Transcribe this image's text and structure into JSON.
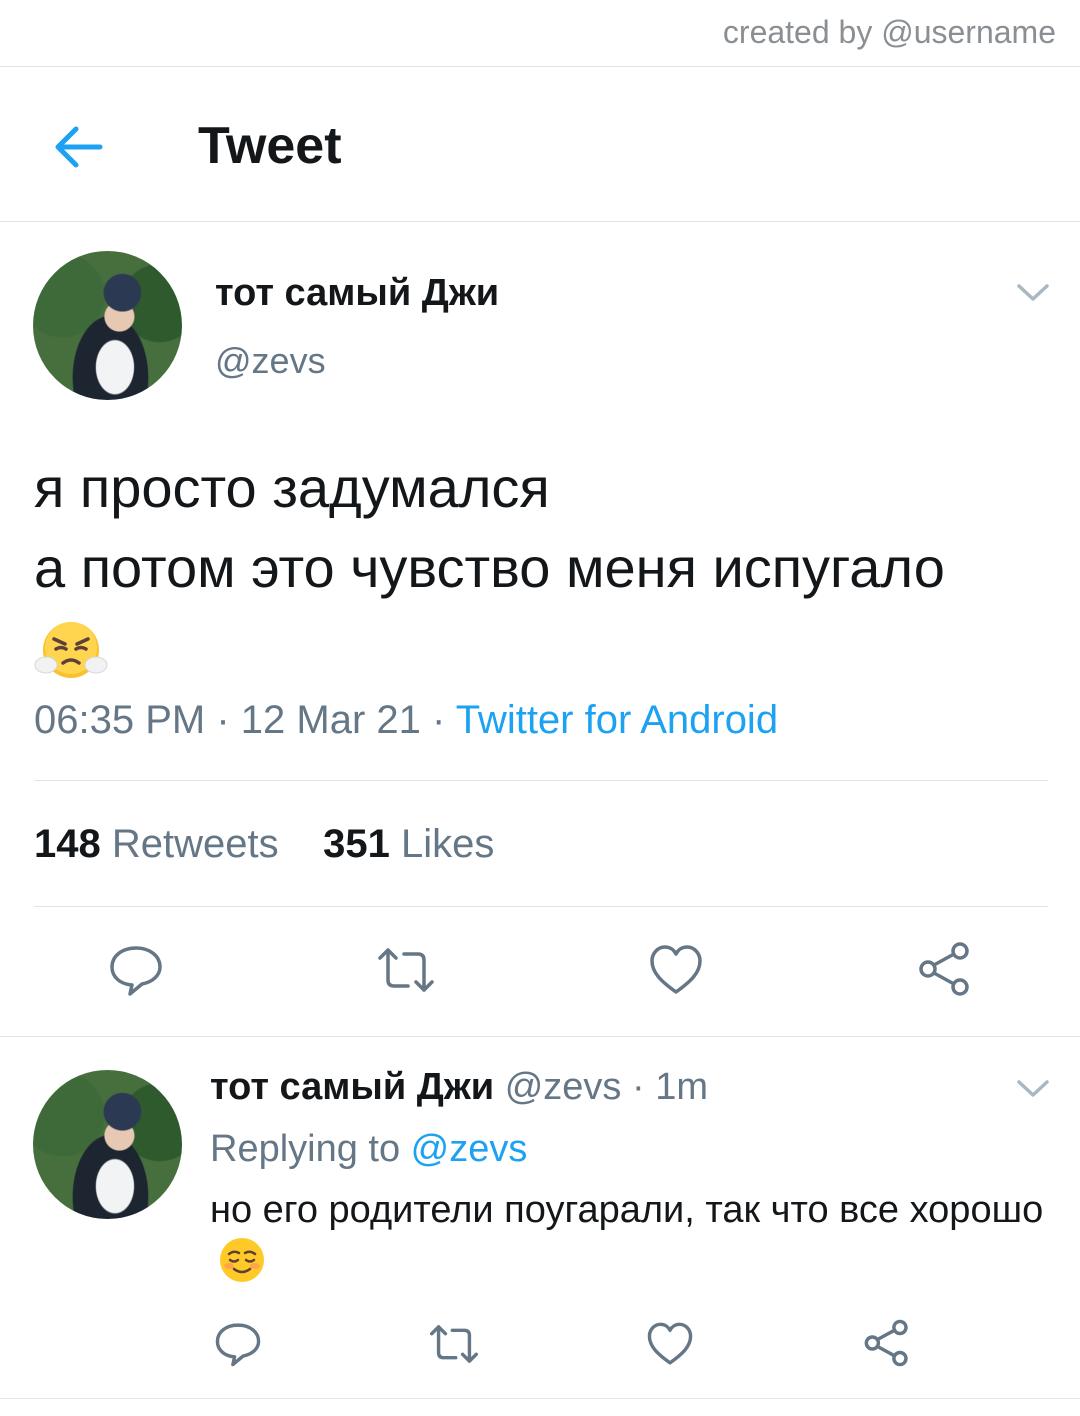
{
  "watermark": "created by @username",
  "header": {
    "title": "Tweet"
  },
  "tweet": {
    "author_name": "тот самый Джи",
    "author_handle": "@zevs",
    "text_line1": "я просто задумался",
    "text_line2": "а потом это чувство меня испугало",
    "time": "06:35 PM",
    "sep1": " · ",
    "date": "12 Mar 21",
    "sep2": " · ",
    "source": "Twitter for Android",
    "retweets_count": "148",
    "retweets_label": "Retweets",
    "likes_count": "351",
    "likes_label": "Likes"
  },
  "reply": {
    "author_name": "тот самый Джи",
    "author_handle": "@zevs",
    "time_ago": " · 1m",
    "replying_to_prefix": "Replying to ",
    "replying_to_user": "@zevs",
    "text": "но его родители поугарали, так что все хорошо"
  },
  "icons": {
    "back": "arrow-left-icon",
    "more": "chevron-down-icon",
    "reply": "comment-icon",
    "retweet": "retweet-icon",
    "like": "heart-icon",
    "share": "share-icon"
  },
  "colors": {
    "accent": "#1da1f2",
    "secondary_text": "#657786",
    "primary_text": "#14171a",
    "divider": "#e1e4e6"
  }
}
